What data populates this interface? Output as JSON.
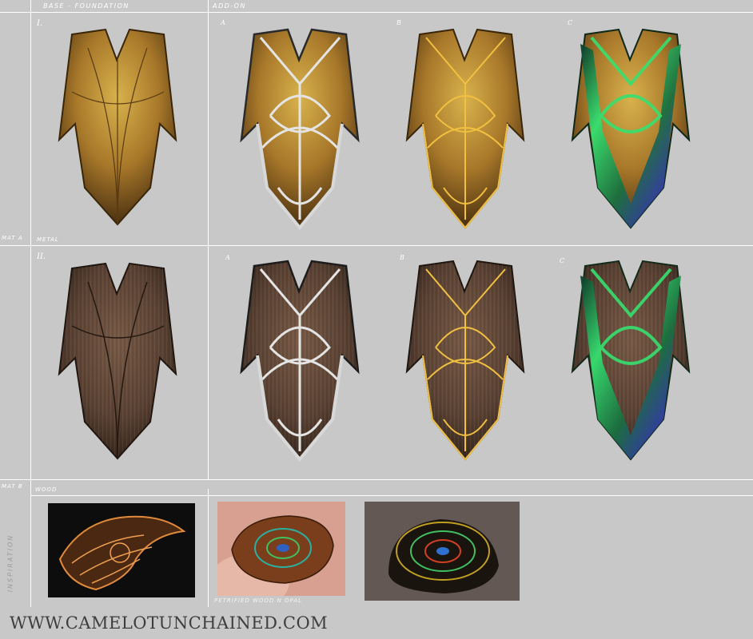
{
  "header": {
    "col_base_label": "BASE - FOUNDATION",
    "col_addon_label": "ADD-ON"
  },
  "rows": [
    {
      "roman": "I.",
      "material_tag": "MAT A",
      "material_name": "METAL",
      "variants": [
        {
          "letter": "",
          "style": "base"
        },
        {
          "letter": "A",
          "style": "silver"
        },
        {
          "letter": "B",
          "style": "gold"
        },
        {
          "letter": "C",
          "style": "opal"
        }
      ]
    },
    {
      "roman": "II.",
      "material_tag": "MAT B",
      "material_name": "WOOD",
      "variants": [
        {
          "letter": "",
          "style": "base"
        },
        {
          "letter": "A",
          "style": "silver"
        },
        {
          "letter": "B",
          "style": "gold"
        },
        {
          "letter": "C",
          "style": "opal"
        }
      ]
    }
  ],
  "inspiration": {
    "section_label": "INSPIRATION",
    "caption": "PETRIFIED WOOD N OPAL",
    "photos": [
      "filigree-gauntlet-photo",
      "petrified-wood-opal-in-hand-photo",
      "petrified-wood-opal-stone-photo"
    ]
  },
  "footer": {
    "url": "WWW.CAMELOTUNCHAINED.COM"
  },
  "colors": {
    "background": "#c8c8c8",
    "grid_lines": "#ffffff",
    "metal_base": "#a8782a",
    "wood_base": "#5a4234",
    "silver_trim": "#e4e4e4",
    "gold_trim": "#f2c040",
    "opal_trim": "#35e070"
  }
}
